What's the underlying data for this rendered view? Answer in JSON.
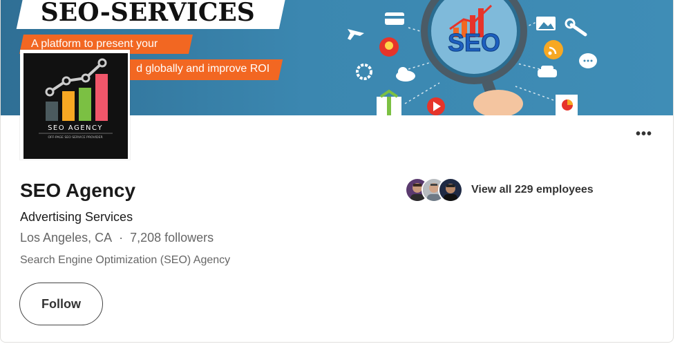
{
  "banner": {
    "headline": "SEO-SERVICES",
    "tagline_line1": "A platform to present your",
    "tagline_line2": "d globally and improve ROI",
    "graphic_text": "SEO"
  },
  "logo": {
    "name": "SEO AGENCY",
    "subtitle": "OFF-PAGE SEO SERVICE PROVIDER"
  },
  "company": {
    "name": "SEO Agency",
    "industry": "Advertising Services",
    "location": "Los Angeles, CA",
    "separator": "·",
    "followers": "7,208 followers",
    "tagline": "Search Engine Optimization (SEO) Agency"
  },
  "actions": {
    "follow_label": "Follow",
    "more_label": "•••"
  },
  "employees": {
    "link_text": "View all 229 employees",
    "avatars": [
      "avatar-1",
      "avatar-2",
      "avatar-3"
    ]
  },
  "colors": {
    "banner_blue": "#3b87b0",
    "banner_orange": "#f26722",
    "text_primary": "#1a1a1a",
    "text_secondary": "#666666"
  }
}
